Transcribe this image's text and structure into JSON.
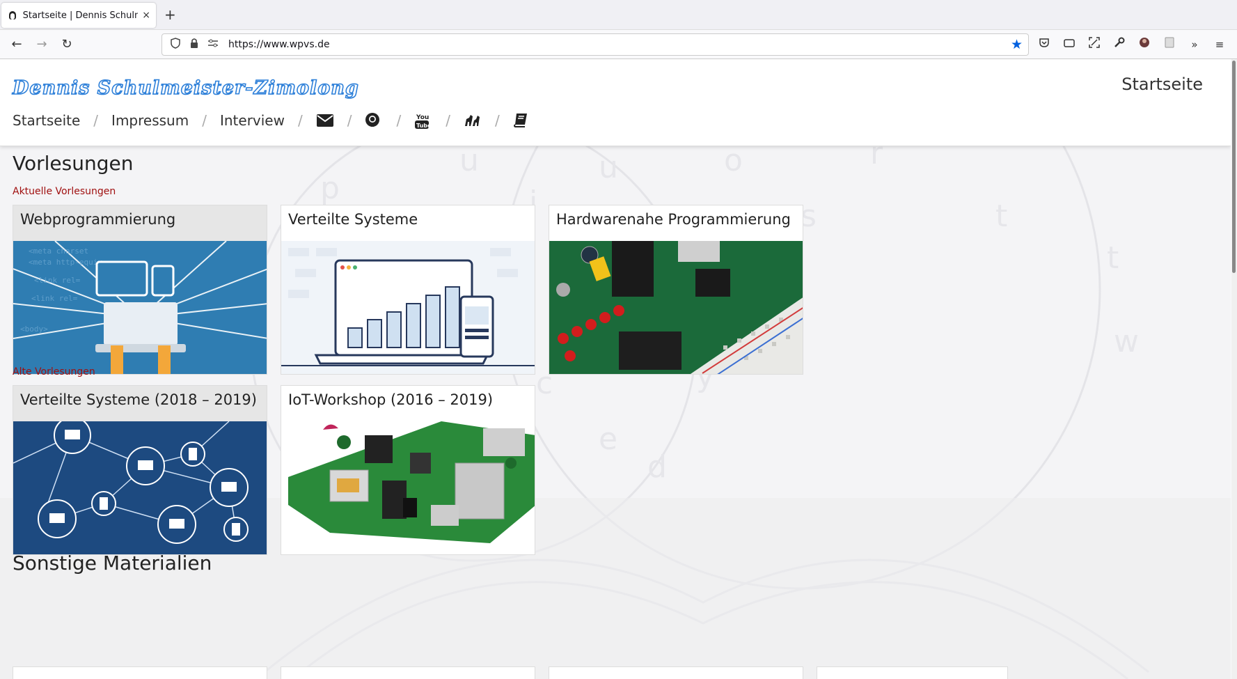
{
  "browser": {
    "tab_title": "Startseite | Dennis Schulm",
    "tab_close": "×",
    "new_tab": "+",
    "url": "https://www.wpvs.de"
  },
  "site": {
    "logo": "Dennis Schulmeister-Zimolong",
    "page_name": "Startseite",
    "nav": {
      "startseite": "Startseite",
      "impressum": "Impressum",
      "interview": "Interview",
      "sep": "/"
    }
  },
  "sections": {
    "vorlesungen": "Vorlesungen",
    "aktuelle": "Aktuelle Vorlesungen",
    "alte": "Alte Vorlesungen",
    "sonstige": "Sonstige Materialien"
  },
  "cards": {
    "webprog": "Webprogrammierung",
    "vs": "Verteilte Systeme",
    "hw": "Hardwarenahe Programmierung",
    "vs_old": "Verteilte Systeme (2018 – 2019)",
    "iot": "IoT-Workshop (2016 – 2019)"
  },
  "colors": {
    "accent_red": "#a01010",
    "logo_blue": "#2e80d9",
    "bookmark_star": "#0060df"
  }
}
